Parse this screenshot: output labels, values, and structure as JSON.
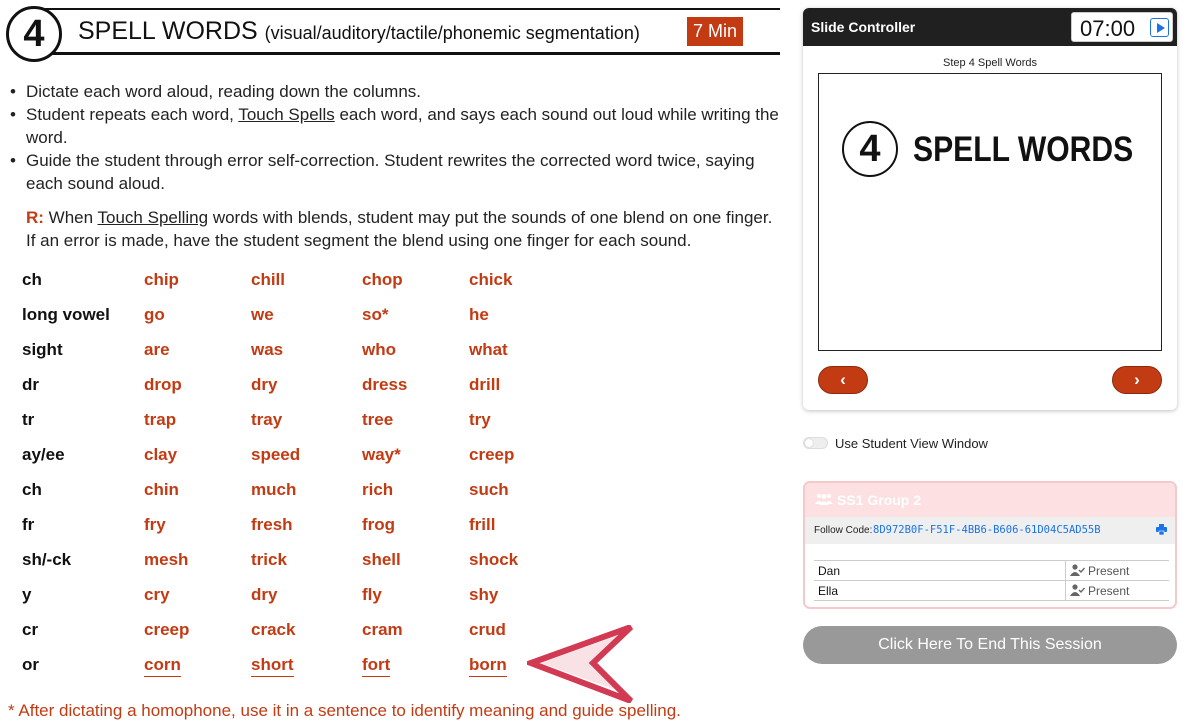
{
  "lesson": {
    "step_number": "4",
    "title": "SPELL WORDS",
    "subtitle": "(visual/auditory/tactile/phonemic segmentation)",
    "duration": "7 Min",
    "bullets": [
      {
        "pre": "Dictate each word aloud, reading down the columns.",
        "link": "",
        "post": ""
      },
      {
        "pre": "Student repeats each word, ",
        "link": "Touch Spells",
        "post": " each word, and says each sound out loud while writing the word."
      },
      {
        "pre": "Guide the student through error self-correction. Student rewrites the corrected word twice, saying each sound aloud.",
        "link": "",
        "post": ""
      }
    ],
    "r_note": {
      "label": "R:",
      "pre": " When ",
      "link": "Touch Spelling",
      "post": " words with blends, student may put the sounds of one blend on one finger. If an error is made, have the student segment the blend using one finger for each sound."
    },
    "word_rows": [
      {
        "pattern": "ch",
        "words": [
          "chip",
          "chill",
          "chop",
          "chick"
        ]
      },
      {
        "pattern": "long vowel",
        "words": [
          "go",
          "we",
          "so*",
          "he"
        ]
      },
      {
        "pattern": "sight",
        "words": [
          "are",
          "was",
          "who",
          "what"
        ]
      },
      {
        "pattern": "dr",
        "words": [
          "drop",
          "dry",
          "dress",
          "drill"
        ]
      },
      {
        "pattern": "tr",
        "words": [
          "trap",
          "tray",
          "tree",
          "try"
        ]
      },
      {
        "pattern": "ay/ee",
        "words": [
          "clay",
          "speed",
          "way*",
          "creep"
        ]
      },
      {
        "pattern": "ch",
        "words": [
          "chin",
          "much",
          "rich",
          "such"
        ]
      },
      {
        "pattern": "fr",
        "words": [
          "fry",
          "fresh",
          "frog",
          "frill"
        ]
      },
      {
        "pattern": "sh/-ck",
        "words": [
          "mesh",
          "trick",
          "shell",
          "shock"
        ]
      },
      {
        "pattern": "y",
        "words": [
          "cry",
          "dry",
          "fly",
          "shy"
        ]
      },
      {
        "pattern": "cr",
        "words": [
          "creep",
          "crack",
          "cram",
          "crud"
        ]
      },
      {
        "pattern": "or",
        "words": [
          "corn",
          "short",
          "fort",
          "born"
        ]
      }
    ],
    "footnote": "* After dictating a homophone, use it in a sentence to identify meaning and guide spelling.",
    "arrow_color": "#d13a52"
  },
  "controller": {
    "title": "Slide Controller",
    "timer": "07:00",
    "slide_label": "Step 4 Spell Words",
    "slide": {
      "step_number": "4",
      "title": "SPELL WORDS"
    },
    "prev_glyph": "‹",
    "next_glyph": "›"
  },
  "student_view_label": "Use Student View Window",
  "group": {
    "name": "SS1 Group 2",
    "follow_label": "Follow Code:",
    "follow_code": "8D972B0F-F51F-4BB6-B606-61D04C5AD55B",
    "students": [
      {
        "name": "Dan",
        "status": "Present"
      },
      {
        "name": "Ella",
        "status": "Present"
      }
    ]
  },
  "end_session_label": "Click Here To End This Session",
  "colors": {
    "accent": "#c23b13",
    "link": "#1a73e8",
    "end_button": "#999999"
  }
}
